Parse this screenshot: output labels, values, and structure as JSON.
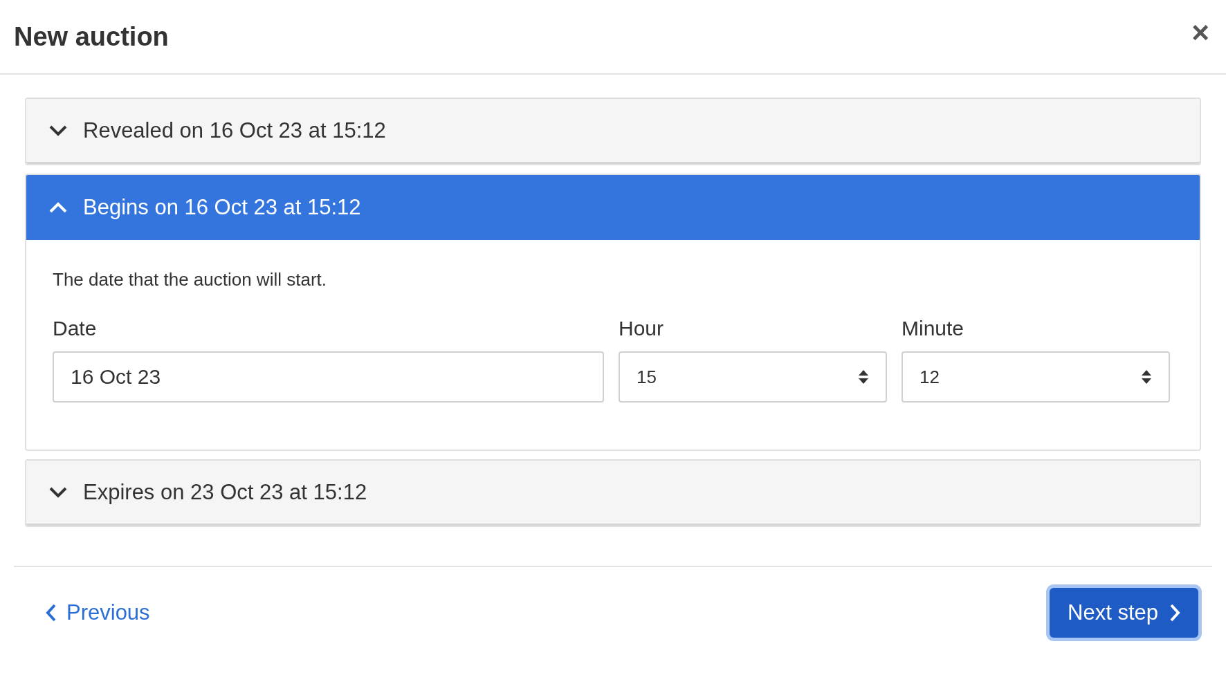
{
  "dialog": {
    "title": "New auction",
    "close": "×"
  },
  "sections": [
    {
      "title": "Revealed on 16 Oct 23 at 15:12",
      "expanded": false
    },
    {
      "title": "Begins on 16 Oct 23 at 15:12",
      "expanded": true,
      "description": "The date that the auction will start.",
      "fields": [
        {
          "kind": "text",
          "label": "Date",
          "value": "16 Oct 23"
        },
        {
          "kind": "select",
          "label": "Hour",
          "value": "15"
        },
        {
          "kind": "select",
          "label": "Minute",
          "value": "12"
        }
      ]
    },
    {
      "title": "Expires on 23 Oct 23 at 15:12",
      "expanded": false
    }
  ],
  "footer": {
    "previous": "Previous",
    "next": "Next step"
  }
}
